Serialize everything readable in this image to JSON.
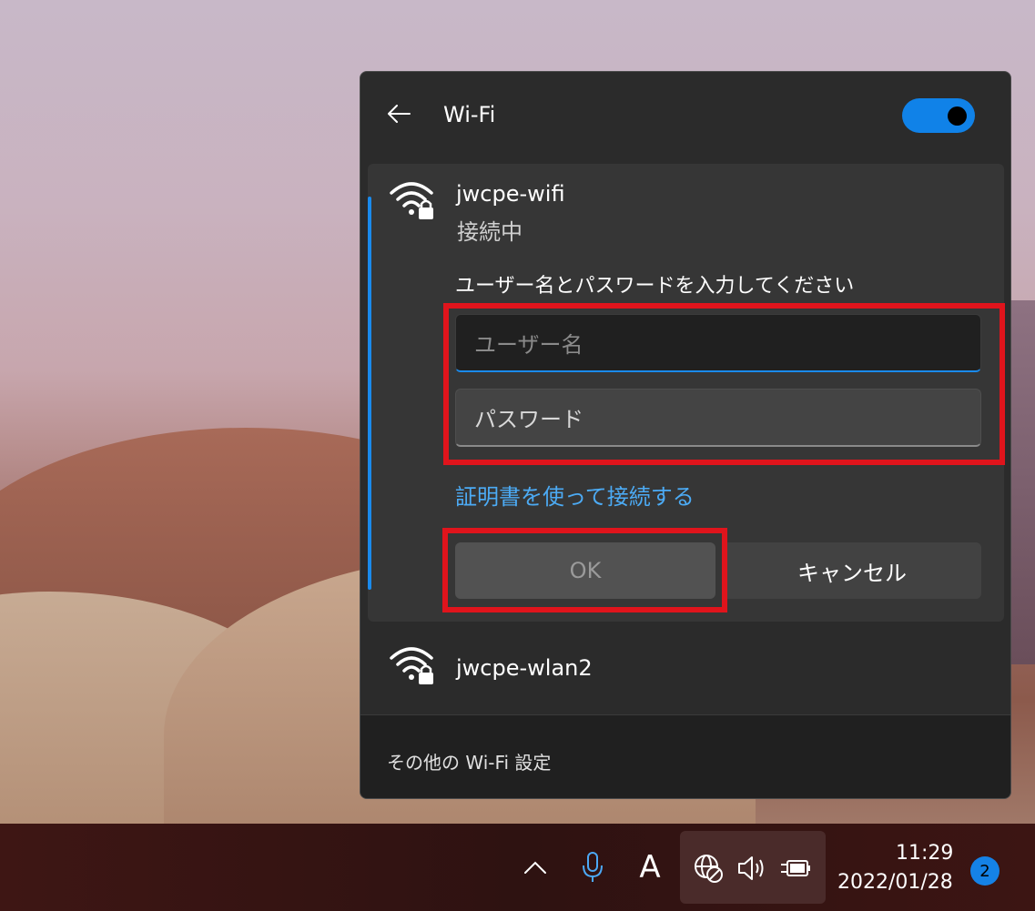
{
  "panel": {
    "title": "Wi-Fi",
    "toggle_state": "on",
    "accent_color": "#1a8aec",
    "networks": [
      {
        "name": "jwcpe-wifi",
        "status": "接続中",
        "icon": "wifi-secured-icon",
        "prompt": "ユーザー名とパスワードを入力してください",
        "username_placeholder": "ユーザー名",
        "password_placeholder": "パスワード",
        "cert_link": "証明書を使って接続する",
        "ok_label": "OK",
        "cancel_label": "キャンセル"
      },
      {
        "name": "jwcpe-wlan2",
        "icon": "wifi-secured-icon"
      }
    ],
    "footer_label": "その他の Wi-Fi 設定"
  },
  "taskbar": {
    "icons": [
      "chevron-up-icon",
      "microphone-icon",
      "ime-icon",
      "globe-icon",
      "speaker-icon",
      "battery-plug-icon"
    ],
    "ime_label": "A",
    "time": "11:29",
    "date": "2022/01/28",
    "notification_count": "2"
  },
  "highlight_color": "#e0141c"
}
